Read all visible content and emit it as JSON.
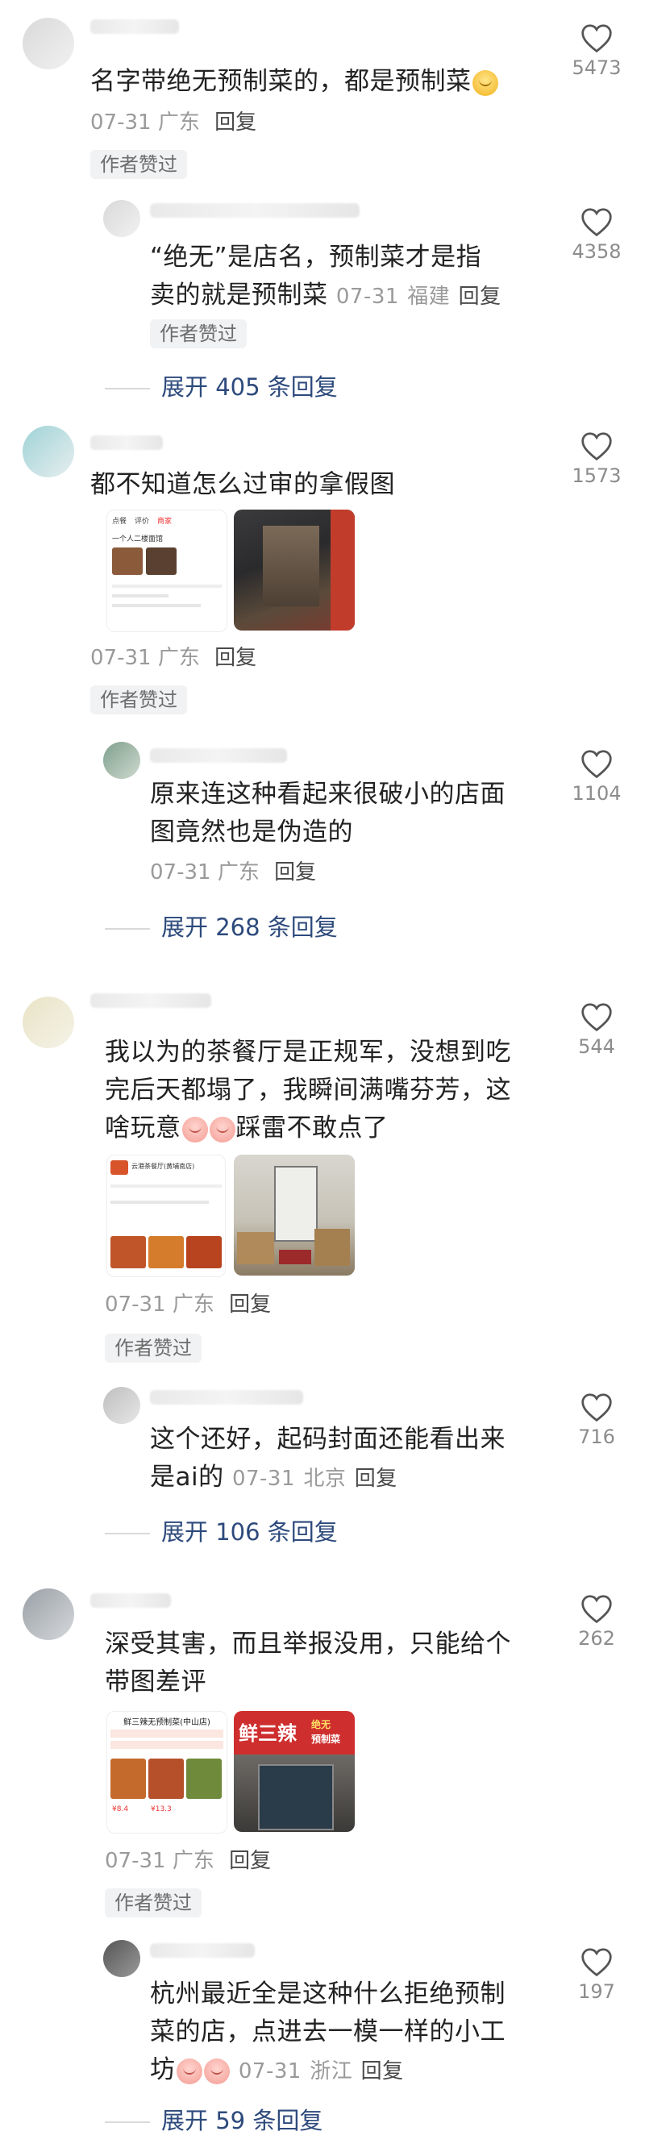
{
  "comments": [
    {
      "text": "名字带绝无预制菜的，都是预制菜",
      "date": "07-31",
      "location": "广东",
      "reply_label": "回复",
      "tag": "作者赞过",
      "likes": "5473",
      "replies": [
        {
          "text_line1": "“绝无”是店名，预制菜才是指",
          "text_line2": "卖的就是预制菜",
          "date": "07-31",
          "location": "福建",
          "reply_label": "回复",
          "tag": "作者赞过",
          "likes": "4358"
        }
      ],
      "expand": "展开 405 条回复"
    },
    {
      "text": "都不知道怎么过审的拿假图",
      "date": "07-31",
      "location": "广东",
      "reply_label": "回复",
      "tag": "作者赞过",
      "likes": "1573",
      "replies": [
        {
          "text_line1": "原来连这种看起来很破小的店面",
          "text_line2": "图竟然也是伪造的",
          "date": "07-31",
          "location": "广东",
          "reply_label": "回复",
          "likes": "1104"
        }
      ],
      "expand": "展开 268 条回复"
    },
    {
      "text_line1": "我以为的茶餐厅是正规军，没想到吃",
      "text_line2": "完后天都塌了，我瞬间满嘴芬芳，这",
      "text_line3a": "啥玩意",
      "text_line3b": "踩雷不敢点了",
      "date": "07-31",
      "location": "广东",
      "reply_label": "回复",
      "tag": "作者赞过",
      "likes": "544",
      "replies": [
        {
          "text_line1": "这个还好，起码封面还能看出来",
          "text_line2": "是ai的",
          "date": "07-31",
          "location": "北京",
          "reply_label": "回复",
          "likes": "716"
        }
      ],
      "expand": "展开 106 条回复"
    },
    {
      "text_line1": "深受其害，而且举报没用，只能给个",
      "text_line2": "带图差评",
      "date": "07-31",
      "location": "广东",
      "reply_label": "回复",
      "tag": "作者赞过",
      "likes": "262",
      "shop_title": "鲜三辣无预制菜(中山店)",
      "sign_main": "鲜三辣",
      "sign_small_1": "绝无",
      "sign_small_2": "预制菜",
      "price_1": "¥8.4",
      "price_2": "¥13.3",
      "replies": [
        {
          "text_line1": "杭州最近全是这种什么拒绝预制",
          "text_line2": "菜的店，点进去一模一样的小工",
          "text_line3": "坊",
          "date": "07-31",
          "location": "浙江",
          "reply_label": "回复",
          "likes": "197"
        }
      ],
      "expand": "展开 59 条回复"
    }
  ],
  "shop_card_1": {
    "tabs": [
      "点餐",
      "评价",
      "商家"
    ],
    "title": "一个人二楼面馆"
  },
  "shop_card_2": {
    "title": "云港茶餐厅(黄埔南店)"
  },
  "colors": {
    "link": "#2d4a7c",
    "meta": "#9a9a9a",
    "tag_bg": "#f1f2f4"
  }
}
